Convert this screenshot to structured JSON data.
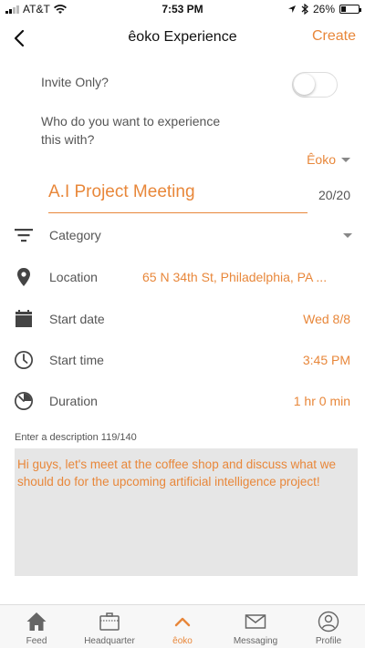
{
  "status_bar": {
    "carrier": "AT&T",
    "time": "7:53 PM",
    "battery": "26%",
    "battery_level": 0.26
  },
  "nav": {
    "title": "êoko Experience",
    "create_label": "Create"
  },
  "form": {
    "invite_only_label": "Invite Only?",
    "invite_only_value": false,
    "who_label": "Who do you want to experience this with?",
    "audience_value": "Êoko",
    "event_name": "A.I Project Meeting",
    "char_count": "20/20",
    "category_label": "Category",
    "location_label": "Location",
    "location_value": "65 N 34th St, Philadelphia, PA ...",
    "start_date_label": "Start date",
    "start_date_value": "Wed 8/8",
    "start_time_label": "Start time",
    "start_time_value": "3:45 PM",
    "duration_label": "Duration",
    "duration_value": "1 hr 0 min",
    "description_label": "Enter a description 119/140",
    "description_value": "Hi guys, let's meet at the coffee shop and discuss what we should do for the upcoming artificial intelligence project!"
  },
  "tabs": [
    {
      "label": "Feed",
      "icon": "home-icon"
    },
    {
      "label": "Headquarter",
      "icon": "briefcase-icon"
    },
    {
      "label": "êoko",
      "icon": "chevron-up-icon"
    },
    {
      "label": "Messaging",
      "icon": "envelope-icon"
    },
    {
      "label": "Profile",
      "icon": "user-icon"
    }
  ],
  "colors": {
    "accent": "#e8873a",
    "text": "#555555",
    "description_bg": "#e6e6e6",
    "tabbar_bg": "#f7f7f7"
  }
}
